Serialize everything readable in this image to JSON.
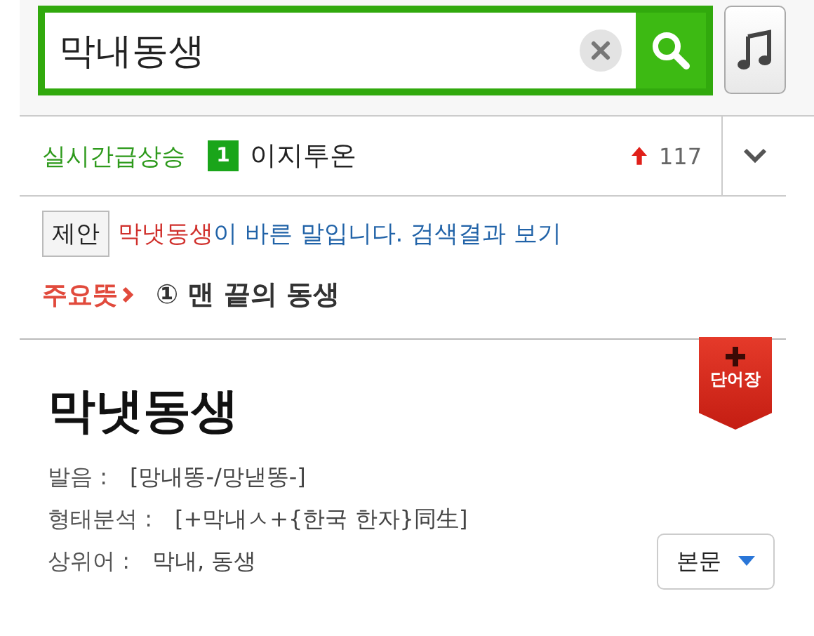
{
  "search": {
    "value": "막내동생"
  },
  "trending": {
    "label": "실시간급상승",
    "rank": "1",
    "term": "이지투온",
    "change": "117"
  },
  "suggestion": {
    "tag": "제안",
    "word": "막냇동생",
    "message": "이 바른 말입니다. 검색결과 보기"
  },
  "main_meaning": {
    "label": "주요뜻",
    "text": "① 맨 끝의 동생"
  },
  "entry": {
    "headword": "막냇동생",
    "bookmark": "단어장",
    "fields": [
      {
        "label": "발음 :",
        "value": "[망내똥-/망낻똥-]"
      },
      {
        "label": "형태분석 :",
        "value": "[+막내ㅅ+{한국 한자}同生]"
      },
      {
        "label": "상위어 :",
        "value": "막내, 동생"
      }
    ],
    "dropdown": "본문"
  }
}
